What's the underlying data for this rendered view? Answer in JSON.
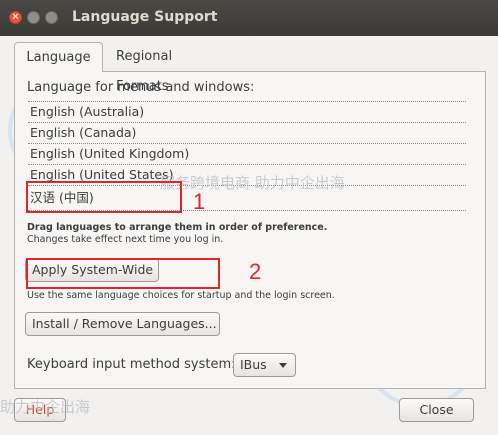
{
  "window": {
    "title": "Language Support",
    "close_glyph": "×"
  },
  "tabs": [
    {
      "label": "Language",
      "active": true
    },
    {
      "label": "Regional Formats",
      "active": false
    }
  ],
  "section_label": "Language for menus and windows:",
  "languages": [
    "English (Australia)",
    "English (Canada)",
    "English (United Kingdom)",
    "English (United States)",
    "汉语 (中国)"
  ],
  "drag_hint": {
    "title": "Drag languages to arrange them in order of preference.",
    "subtitle": "Changes take effect next time you log in."
  },
  "apply_button": "Apply System-Wide",
  "apply_note": "Use the same language choices for startup and the login screen.",
  "install_button": "Install / Remove Languages...",
  "keyboard_label": "Keyboard input method system:",
  "keyboard_value": "IBus",
  "help_button": "Help",
  "close_button": "Close",
  "annotations": [
    "1",
    "2"
  ],
  "watermark": {
    "top_text": "服务跨境电商 助力中企出海",
    "bottom_text": "助力中企出海"
  },
  "colors": {
    "highlight": "#e0252d",
    "titlebar": "#3b3a36",
    "close_button": "#e8573a"
  }
}
